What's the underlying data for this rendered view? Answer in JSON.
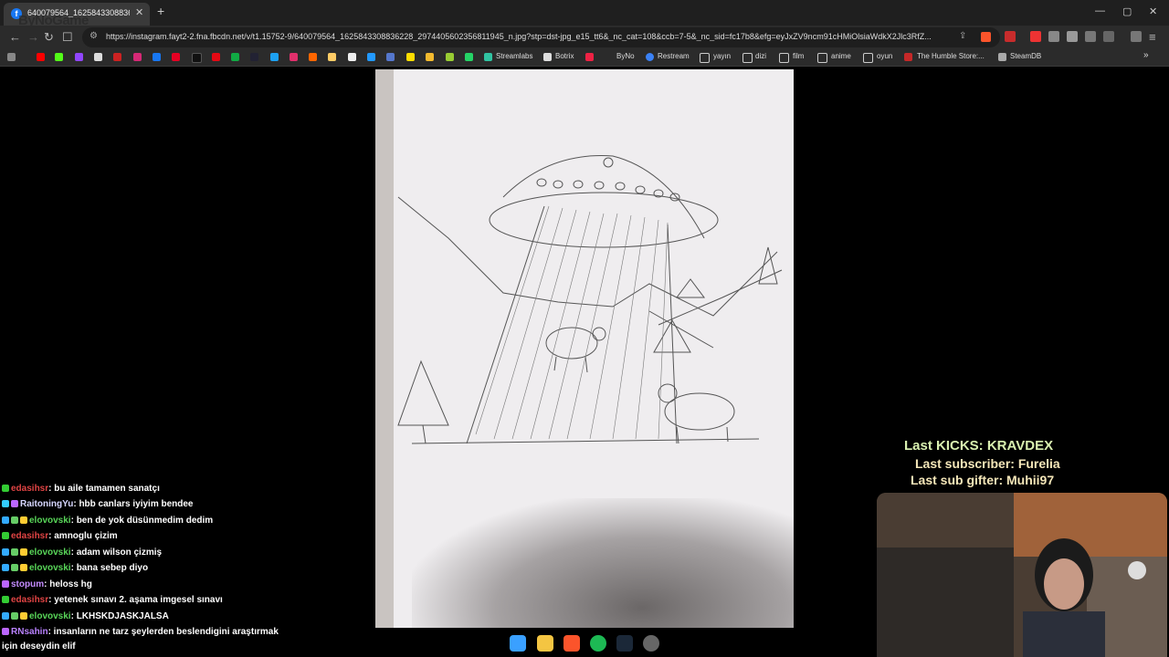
{
  "browser": {
    "tab_title": "640079564_1625843308836228...",
    "tab_favicon": "f",
    "overlay_logo": "ByNoGame",
    "url": "https://instagram.fayt2-2.fna.fbcdn.net/v/t1.15752-9/640079564_1625843308836228_2974405602356811945_n.jpg?stp=dst-jpg_e15_tt6&_nc_cat=108&ccb=7-5&_nc_sid=fc17b8&efg=eyJxZV9ncm91cHMiOlsiaWdkX2Jlc3RfZ...",
    "window_controls": [
      "—",
      "▢",
      "✕"
    ],
    "nav": {
      "back": "←",
      "forward": "→",
      "reload": "↻",
      "bookmark": "☐"
    }
  },
  "bookmarks": [
    {
      "label": "Streamlabs",
      "icon": "streamlabs-icon"
    },
    {
      "label": "Botrix",
      "icon": "botrix-icon"
    },
    {
      "label": "ByNo",
      "icon": "byno-icon"
    },
    {
      "label": "Restream",
      "icon": "restream-icon"
    },
    {
      "label": "yayın",
      "icon": "folder-icon"
    },
    {
      "label": "dizi",
      "icon": "folder-icon"
    },
    {
      "label": "film",
      "icon": "folder-icon"
    },
    {
      "label": "anime",
      "icon": "folder-icon"
    },
    {
      "label": "oyun",
      "icon": "folder-icon"
    },
    {
      "label": "The Humble Store:...",
      "icon": "humble-icon"
    },
    {
      "label": "SteamDB",
      "icon": "steamdb-icon"
    }
  ],
  "chat": [
    {
      "user": "edasihsr",
      "color": "#e04444",
      "message": ": bu aile tamamen sanatçı"
    },
    {
      "user": "RaitoningYu",
      "color": "#d6d6ff",
      "message": ": hbb canlars iyiyim bendee"
    },
    {
      "user": "elovovski",
      "color": "#59d659",
      "message": ": ben de yok düsünmedim dedim"
    },
    {
      "user": "edasihsr",
      "color": "#e04444",
      "message": ": amnoglu çizim"
    },
    {
      "user": "elovovski",
      "color": "#59d659",
      "message": ": adam wilson çizmiş"
    },
    {
      "user": "elovovski",
      "color": "#59d659",
      "message": ": bana sebep diyo"
    },
    {
      "user": "stopum",
      "color": "#c48cff",
      "message": ": heloss hg"
    },
    {
      "user": "edasihsr",
      "color": "#e04444",
      "message": ": yetenek sınavı 2. aşama imgesel sınavı"
    },
    {
      "user": "elovovski",
      "color": "#59d659",
      "message": ": LKHSKDJASKJALSA"
    },
    {
      "user": "RNsahin",
      "color": "#b982ff",
      "message": ": insanların ne tarz şeylerden beslendigini araştırmak"
    },
    {
      "user": "",
      "color": "#ffffff",
      "message": "için deseydin elif"
    }
  ],
  "overlay": {
    "kicks": "Last KICKS: KRAVDEX",
    "subscriber": "Last subscriber: Furelia",
    "gifter": "Last sub gifter: Muhii97"
  },
  "taskbar": [
    "windows-start-icon",
    "file-explorer-icon",
    "brave-icon",
    "spotify-icon",
    "steam-icon",
    "github-desktop-icon"
  ]
}
